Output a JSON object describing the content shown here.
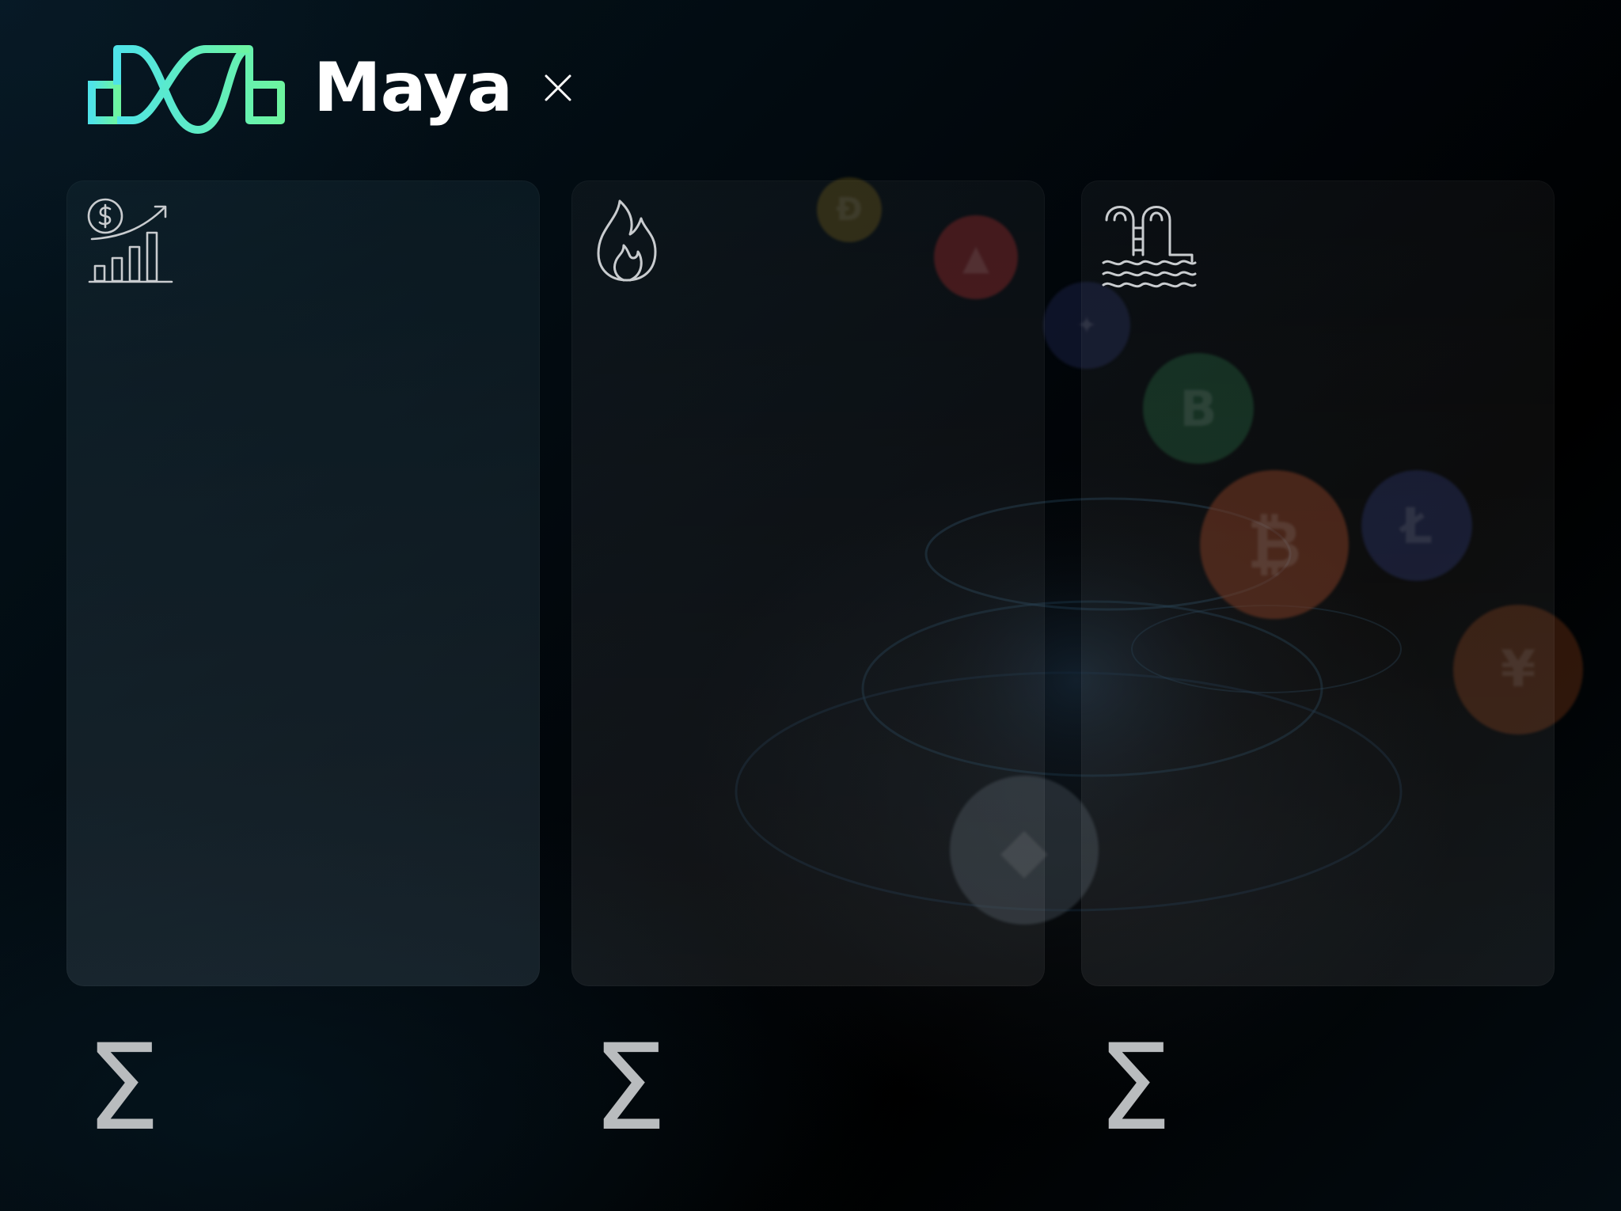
{
  "header": {
    "brand_name": "Maya",
    "logo_icon": "maya-wave-logo-icon",
    "close_icon": "close-icon"
  },
  "cards": [
    {
      "icon": "revenue-growth-chart-icon"
    },
    {
      "icon": "flame-icon"
    },
    {
      "icon": "swimming-pool-icon"
    }
  ],
  "totals": [
    {
      "symbol": "Σ"
    },
    {
      "symbol": "Σ"
    },
    {
      "symbol": "Σ"
    }
  ],
  "colors": {
    "background": "#01070c",
    "logo_gradient_start": "#4fe3e8",
    "logo_gradient_end": "#6df5a0",
    "text_primary": "#ffffff",
    "icon_stroke": "#c9cccf"
  }
}
